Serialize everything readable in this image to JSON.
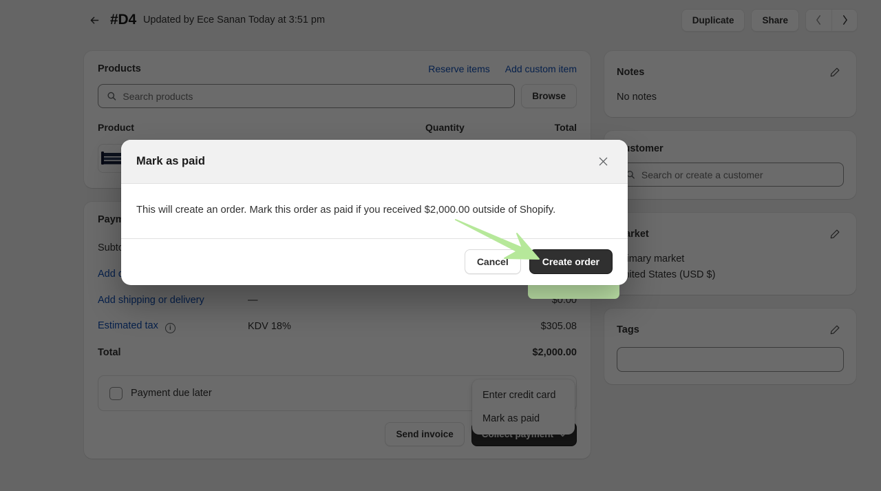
{
  "topbar": {
    "back_icon": "arrow-left-icon",
    "order_id": "#D4",
    "updated_text": "Updated by Ece Sanan Today at 3:51 pm",
    "duplicate_label": "Duplicate",
    "share_label": "Share",
    "prev_icon": "chevron-left-icon",
    "next_icon": "chevron-right-icon"
  },
  "products_card": {
    "title": "Products",
    "reserve_items_label": "Reserve items",
    "add_custom_item_label": "Add custom item",
    "search_placeholder": "Search products",
    "search_value": "",
    "search_icon": "search-icon",
    "browse_label": "Browse",
    "columns": {
      "product": "Product",
      "quantity": "Quantity",
      "total": "Total"
    },
    "rows": [
      {
        "thumb": "product-thumbnail",
        "name": "",
        "quantity": "",
        "total": ""
      }
    ]
  },
  "payment_card": {
    "title": "Payment",
    "rows": [
      {
        "label": "Subtotal",
        "label_link": false,
        "mid": "",
        "amount": ""
      },
      {
        "label": "Add discount",
        "label_link": true,
        "mid": "",
        "amount": ""
      },
      {
        "label": "Add shipping or delivery",
        "label_link": true,
        "mid": "—",
        "amount": "$0.00"
      },
      {
        "label": "Estimated tax",
        "label_link": true,
        "mid": "KDV 18%",
        "amount": "$305.08",
        "info_icon": "info-icon"
      },
      {
        "label": "Total",
        "label_link": false,
        "mid": "",
        "amount": "$2,000.00"
      }
    ],
    "due_later_label": "Payment due later",
    "due_later_checked": false,
    "send_invoice_label": "Send invoice",
    "collect_payment_label": "Collect payment",
    "collect_chevron_icon": "chevron-down-icon"
  },
  "collect_menu": {
    "items": [
      {
        "label": "Enter credit card"
      },
      {
        "label": "Mark as paid"
      }
    ]
  },
  "sidebar": {
    "notes": {
      "title": "Notes",
      "edit_icon": "pencil-icon",
      "body": "No notes"
    },
    "customer": {
      "title": "Customer",
      "search_icon": "search-icon",
      "search_placeholder": "Search or create a customer",
      "search_value": ""
    },
    "market": {
      "title": "Market",
      "edit_icon": "pencil-icon",
      "line1": "Primary market",
      "line2": "United States (USD $)"
    },
    "tags": {
      "title": "Tags",
      "edit_icon": "pencil-icon",
      "value": ""
    }
  },
  "modal": {
    "title": "Mark as paid",
    "close_icon": "close-icon",
    "body": "This will create an order. Mark this order as paid if you received $2,000.00 outside of Shopify.",
    "cancel_label": "Cancel",
    "create_label": "Create order"
  },
  "annotation": {
    "highlight_color": "#c9f1b2",
    "arrow_color": "#b6e89a",
    "target": "Create order"
  }
}
